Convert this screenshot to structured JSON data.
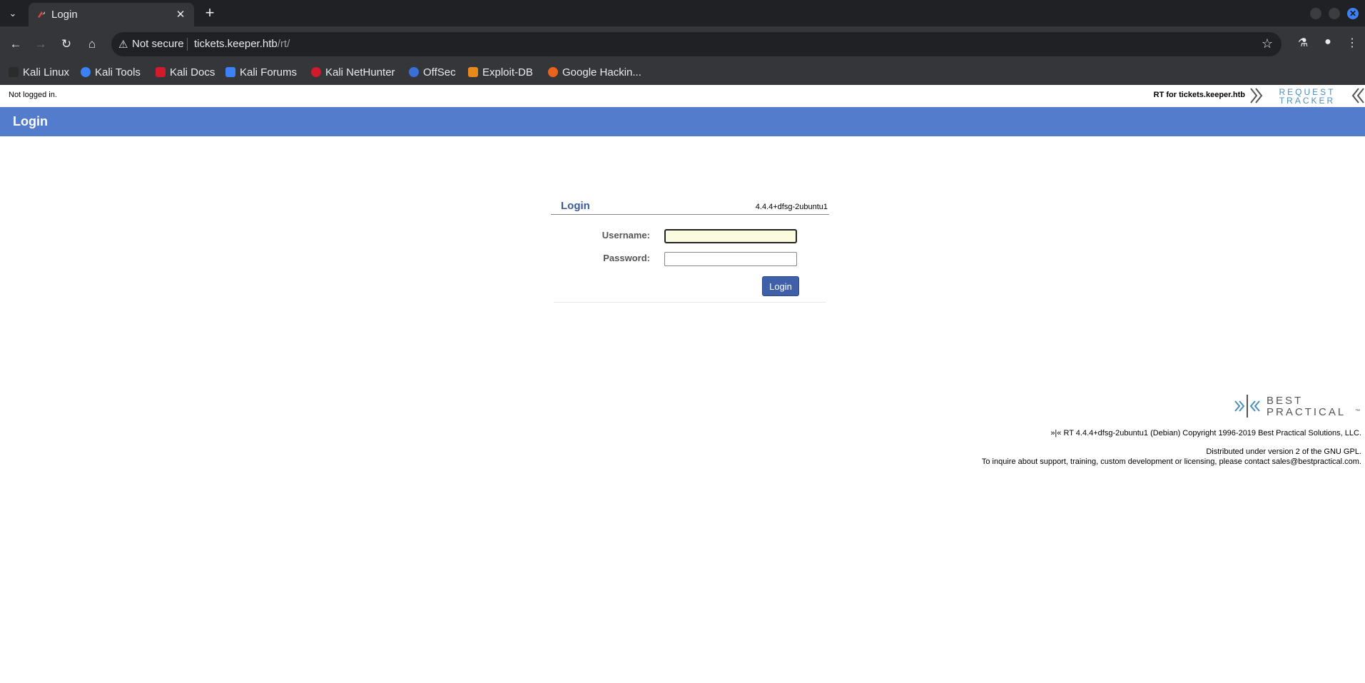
{
  "browser": {
    "tab_title": "Login",
    "new_tab_symbol": "+",
    "tab_close_symbol": "✕",
    "omnibox": {
      "security_label": "Not secure",
      "url_host": "tickets.keeper.htb",
      "url_path": "/rt/"
    },
    "bookmarks": [
      {
        "label": "Kali Linux",
        "icon": "kali-linux-icon",
        "color": "#2b2b2b"
      },
      {
        "label": "Kali Tools",
        "icon": "kali-tools-icon",
        "color": "#3b82f6"
      },
      {
        "label": "Kali Docs",
        "icon": "kali-docs-icon",
        "color": "#d11a2a"
      },
      {
        "label": "Kali Forums",
        "icon": "kali-forums-icon",
        "color": "#3b82f6"
      },
      {
        "label": "Kali NetHunter",
        "icon": "kali-nethunter-icon",
        "color": "#d11a2a"
      },
      {
        "label": "OffSec",
        "icon": "offsec-icon",
        "color": "#3b6fd8"
      },
      {
        "label": "Exploit-DB",
        "icon": "exploit-db-icon",
        "color": "#e8891c"
      },
      {
        "label": "Google Hackin...",
        "icon": "google-hacking-icon",
        "color": "#e8631c"
      }
    ]
  },
  "page": {
    "status": "Not logged in.",
    "rt_for": "RT for tickets.keeper.htb",
    "header_title": "Login",
    "login_box": {
      "title": "Login",
      "version": "4.4.4+dfsg-2ubuntu1",
      "username_label": "Username:",
      "password_label": "Password:",
      "username_value": "",
      "password_value": "",
      "submit_label": "Login"
    },
    "footer": {
      "copyright": "»|« RT 4.4.4+dfsg-2ubuntu1 (Debian) Copyright 1996-2019 Best Practical Solutions, LLC.",
      "license": "Distributed under version 2 of the GNU GPL.",
      "contact": "To inquire about support, training, custom development or licensing, please contact sales@bestpractical.com."
    },
    "logos": {
      "request_line1": "REQUEST",
      "request_line2": "TRACKER",
      "best_line1": "BEST",
      "best_line2": "PRACTICAL",
      "trademark": "™"
    }
  },
  "colors": {
    "header_band": "#547ccc",
    "login_button": "#3f5fa8",
    "logo_blue": "#4a8fbe"
  }
}
